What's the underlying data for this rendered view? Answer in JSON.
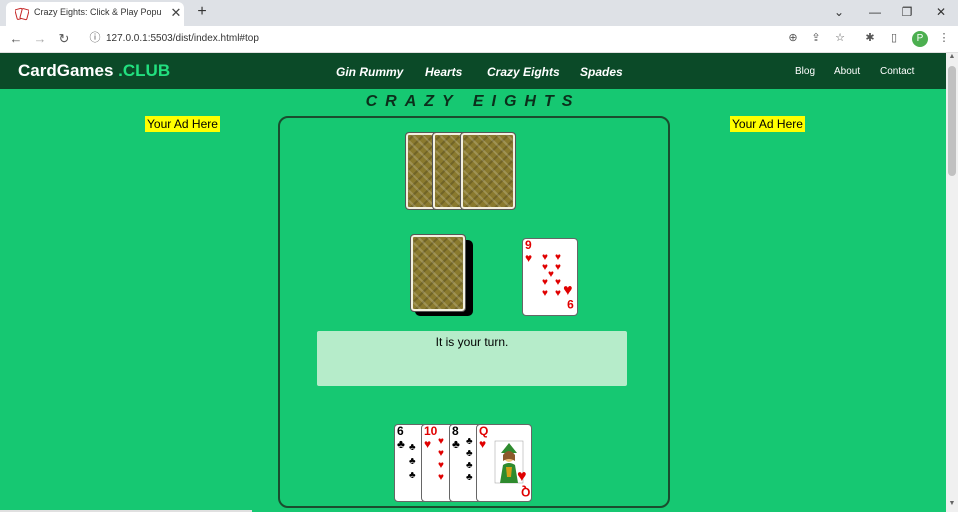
{
  "browser": {
    "tab_title": "Crazy Eights: Click & Play Popula",
    "tab_close": "✕",
    "new_tab": "+",
    "url": "127.0.0.1:5503/dist/index.html#top",
    "profile_initial": "P"
  },
  "site": {
    "logo_main": "CardGames",
    "logo_club": ".CLUB",
    "nav": [
      "Gin Rummy",
      "Hearts",
      "Crazy Eights",
      "Spades"
    ],
    "links": [
      "Blog",
      "About",
      "Contact"
    ]
  },
  "game": {
    "title": "CRAZY EIGHTS",
    "ad_left": "Your Ad Here",
    "ad_right": "Your Ad Here",
    "message": "It is your turn.",
    "opponent_cards": 3,
    "discard": {
      "rank": "9",
      "suit": "♥",
      "color": "#e00000"
    },
    "hand": [
      {
        "rank": "6",
        "suit": "♣",
        "color": "#000000"
      },
      {
        "rank": "10",
        "suit": "♥",
        "color": "#e00000"
      },
      {
        "rank": "8",
        "suit": "♣",
        "color": "#000000"
      },
      {
        "rank": "Q",
        "suit": "♥",
        "color": "#e00000"
      }
    ]
  },
  "colors": {
    "felt": "#16c872",
    "header": "#0b4a28",
    "accent": "#22e07f",
    "ad": "#ffff00",
    "message_bg": "#b6ecca"
  }
}
